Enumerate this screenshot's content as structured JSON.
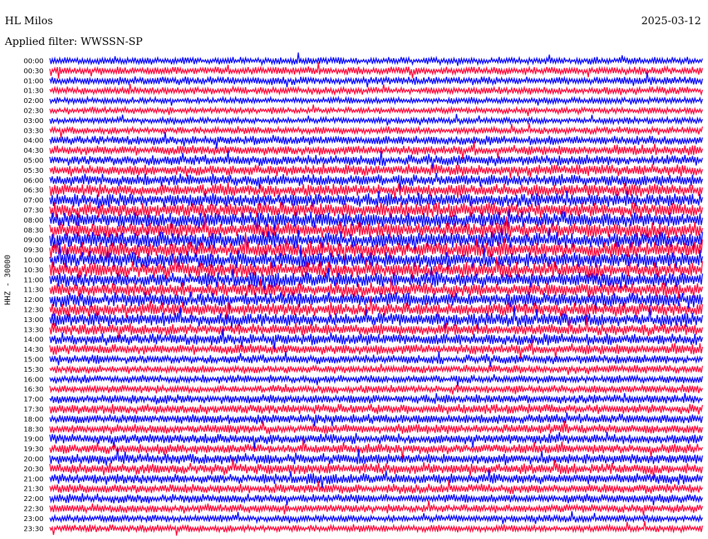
{
  "header": {
    "station": "HL Milos",
    "filter": "Applied filter: WWSSN-SP",
    "date": "2025-03-12"
  },
  "chart_data": {
    "type": "line",
    "title": "HL Milos",
    "subtitle": "Applied filter: WWSSN-SP",
    "date": "2025-03-12",
    "ylabel": "HHZ - 30000",
    "xlabel": "",
    "x_range_minutes": [
      0,
      30
    ],
    "row_labels": [
      "00:00",
      "00:30",
      "01:00",
      "01:30",
      "02:00",
      "02:30",
      "03:00",
      "03:30",
      "04:00",
      "04:30",
      "05:00",
      "05:30",
      "06:00",
      "06:30",
      "07:00",
      "07:30",
      "08:00",
      "08:30",
      "09:00",
      "09:30",
      "10:00",
      "10:30",
      "11:00",
      "11:30",
      "12:00",
      "12:30",
      "13:00",
      "13:30",
      "14:00",
      "14:30",
      "15:00",
      "15:30",
      "16:00",
      "16:30",
      "17:00",
      "17:30",
      "18:00",
      "18:30",
      "19:00",
      "19:30",
      "20:00",
      "20:30",
      "21:00",
      "21:30",
      "22:00",
      "22:30",
      "23:00",
      "23:30"
    ],
    "series_colors": [
      "#0000ff",
      "#ff0033"
    ],
    "relative_amplitude": [
      0.45,
      0.5,
      0.5,
      0.45,
      0.4,
      0.38,
      0.4,
      0.45,
      0.55,
      0.6,
      0.65,
      0.7,
      0.75,
      0.8,
      0.85,
      0.95,
      1.0,
      1.0,
      1.0,
      1.0,
      1.0,
      0.95,
      0.95,
      0.9,
      0.9,
      0.85,
      0.85,
      0.75,
      0.7,
      0.65,
      0.55,
      0.5,
      0.5,
      0.5,
      0.55,
      0.6,
      0.6,
      0.6,
      0.6,
      0.6,
      0.65,
      0.65,
      0.65,
      0.6,
      0.55,
      0.5,
      0.45,
      0.45
    ],
    "grid": false,
    "legend": "none"
  }
}
